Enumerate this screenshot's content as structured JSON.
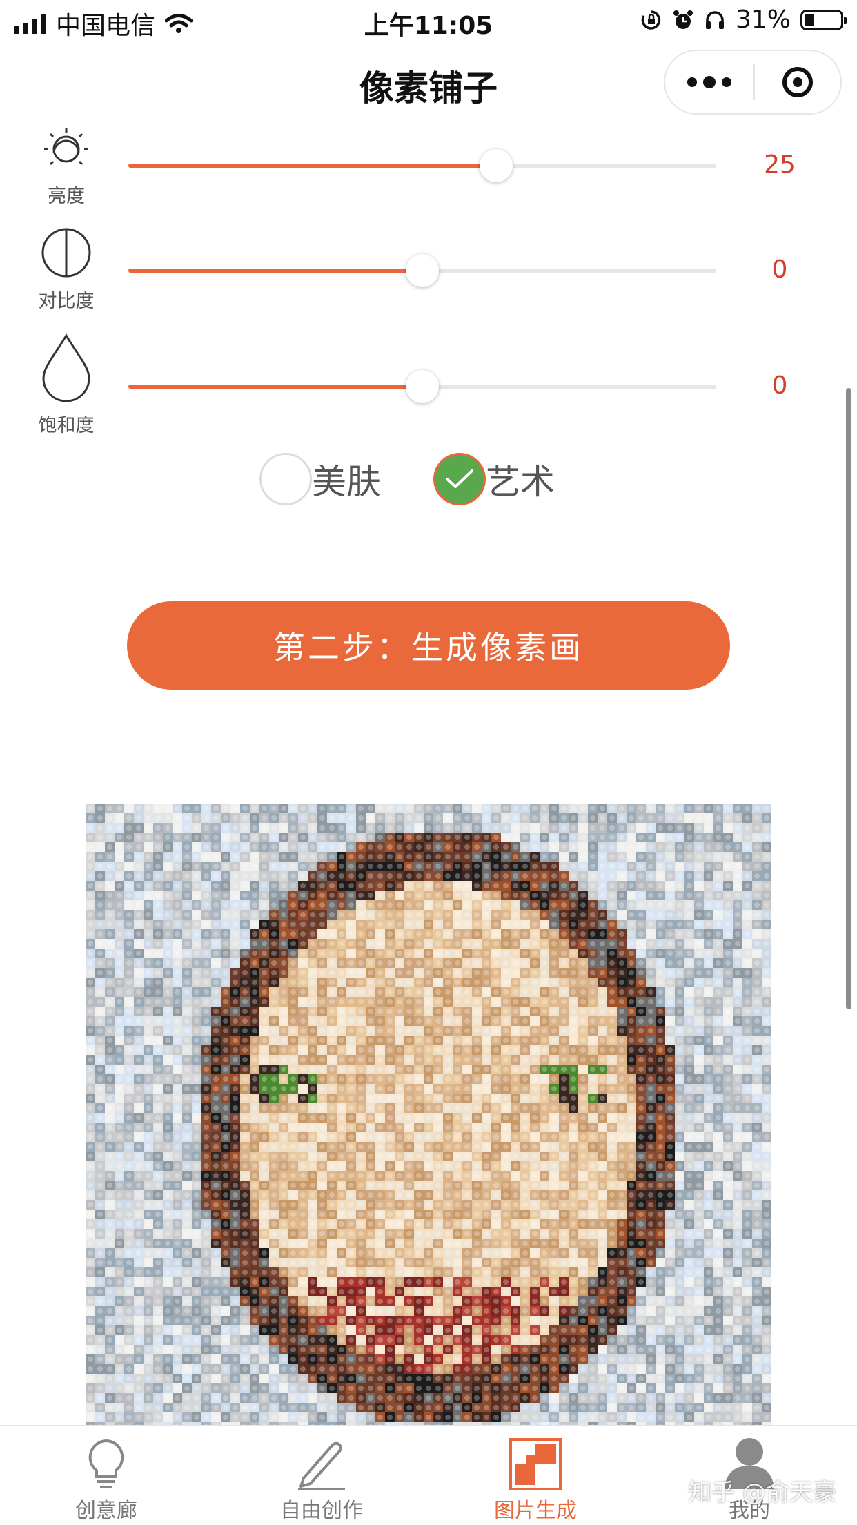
{
  "status_bar": {
    "carrier": "中国电信",
    "time": "上午11:05",
    "battery": "31%",
    "battery_level": 0.31
  },
  "nav": {
    "title": "像素铺子"
  },
  "adjustments": [
    {
      "label": "亮度",
      "icon": "sun-icon",
      "value": "25",
      "fraction": 0.625
    },
    {
      "label": "对比度",
      "icon": "contrast-icon",
      "value": "0",
      "fraction": 0.5
    },
    {
      "label": "饱和度",
      "icon": "droplet-icon",
      "value": "0",
      "fraction": 0.5
    }
  ],
  "options": {
    "skin": {
      "label": "美肤",
      "checked": false
    },
    "art": {
      "label": "艺术",
      "checked": true
    }
  },
  "actions": {
    "generate_label": "第二步：生成像素画"
  },
  "tabs": [
    {
      "label": "创意廊",
      "icon": "lightbulb-icon",
      "active": false
    },
    {
      "label": "自由创作",
      "icon": "pencil-icon",
      "active": false
    },
    {
      "label": "图片生成",
      "icon": "pixel-image-icon",
      "active": true
    },
    {
      "label": "我的",
      "icon": "user-icon",
      "active": false
    }
  ],
  "watermark": "知乎 @俞天豪",
  "colors": {
    "accent": "#e9673a",
    "value_red": "#d0412c",
    "check_green": "#5aa84d"
  }
}
